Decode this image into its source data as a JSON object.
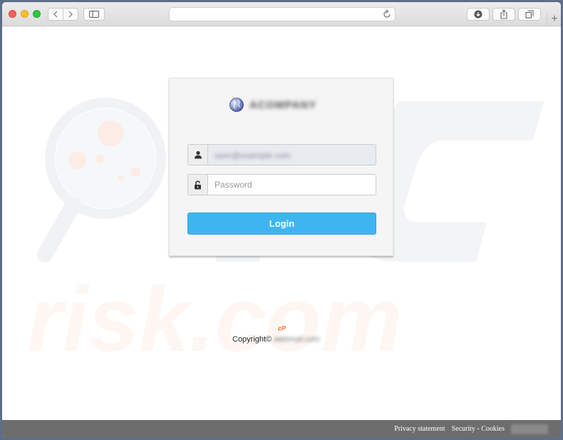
{
  "browser": {
    "address_bar": "",
    "icons": [
      "back-arrow-icon",
      "forward-arrow-icon",
      "sidebar-icon",
      "reload-icon",
      "download-icon",
      "share-icon",
      "tabs-icon",
      "plus-icon"
    ],
    "new_tab_label": "+"
  },
  "watermark": {
    "text": "risk.com",
    "brand": "PC"
  },
  "login": {
    "brand_name": "ACOMPANY",
    "username_value": "user@example.com",
    "password_placeholder": "Password",
    "login_label": "Login"
  },
  "footer": {
    "cpanel_mark": "cP",
    "copyright_label": "Copyright©",
    "copyright_owner": "webmail.com"
  },
  "bottom_bar": {
    "privacy": "Privacy statement",
    "security": "Security - Cookies"
  },
  "colors": {
    "login_button": "#3fb5ef",
    "cpanel_mark": "#ff6c2c",
    "bottom_bar": "#6d6d6d"
  }
}
